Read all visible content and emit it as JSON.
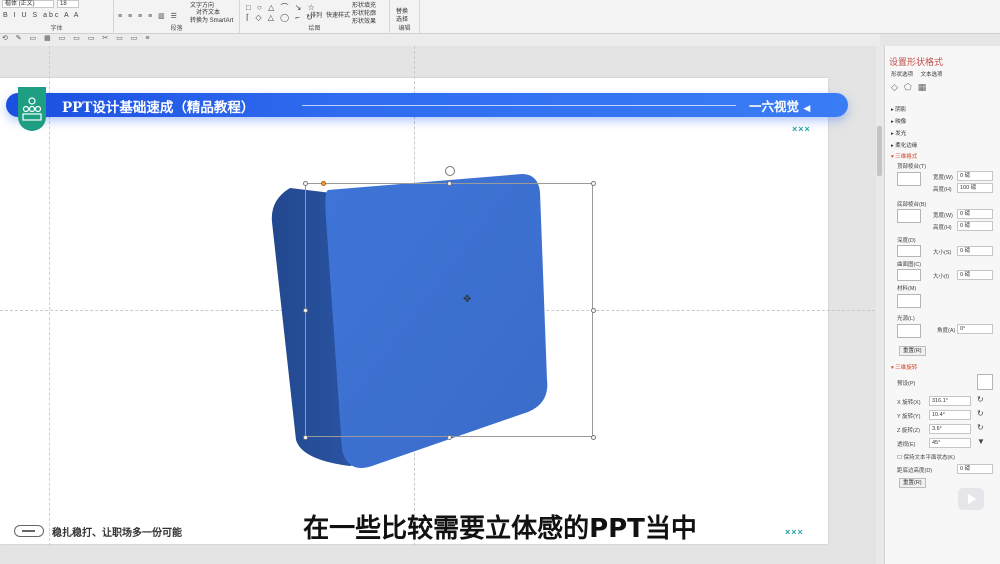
{
  "ribbon": {
    "font_name": "楷体 (正文)",
    "font_size": "18",
    "font_group_label": "字体",
    "paragraph_group_label": "段落",
    "drawing_group_label": "绘图",
    "editing_group_label": "编辑",
    "text_direction": "文字方向",
    "align_text": "对齐文本",
    "convert_smartart": "转换为 SmartArt",
    "arrange": "排列",
    "quick_styles": "快速样式",
    "shape_fill": "形状填充",
    "shape_outline": "形状轮廓",
    "shape_effects": "形状效果",
    "replace": "替换",
    "select": "选择"
  },
  "slide": {
    "title": "PPT设计基础速成（精品教程）",
    "brand": "一六视觉",
    "brand_arrow": "◀",
    "deco_top": "×××",
    "deco_bottom": "×××",
    "footer_slogan": "稳扎稳打、让职场多一份可能",
    "shape_color": "#3f74d8"
  },
  "subtitle": "在一些比较需要立体感的PPT当中",
  "pane": {
    "title": "设置形状格式",
    "tab_shape": "形状选项",
    "tab_text": "文本选项",
    "sections": {
      "shadow": "阴影",
      "reflection": "映像",
      "glow": "发光",
      "soft_edges": "柔化边缘",
      "format_3d": "三维格式",
      "rotation_3d": "三维旋转"
    },
    "bevel_top": "顶部棱台(T)",
    "bevel_bottom": "底部棱台(B)",
    "width_label": "宽度(W)",
    "height_label": "高度(H)",
    "top_width": "0 磅",
    "top_height": "100 磅",
    "bottom_width": "0 磅",
    "bottom_height": "0 磅",
    "depth_label": "深度(D)",
    "depth_size_label": "大小(S)",
    "depth_value": "0 磅",
    "contour_label": "曲面图(C)",
    "contour_size_label": "大小(I)",
    "contour_value": "0 磅",
    "material_label": "材料(M)",
    "lighting_label": "光源(L)",
    "angle_label": "角度(A)",
    "angle_value": "0°",
    "reset_button": "重置(R)",
    "presets_label": "预设(P)",
    "x_rotation_label": "X 旋转(X)",
    "x_rotation": "316.1°",
    "y_rotation_label": "Y 旋转(Y)",
    "y_rotation": "10.4°",
    "z_rotation_label": "Z 旋转(Z)",
    "z_rotation": "3.6°",
    "perspective_label": "透视(E)",
    "perspective": "45°",
    "keep_text_flat": "保持文本平面状态(K)",
    "distance_label": "距底边高度(D)",
    "distance": "0 磅",
    "reset_button_2": "重置(R)"
  }
}
